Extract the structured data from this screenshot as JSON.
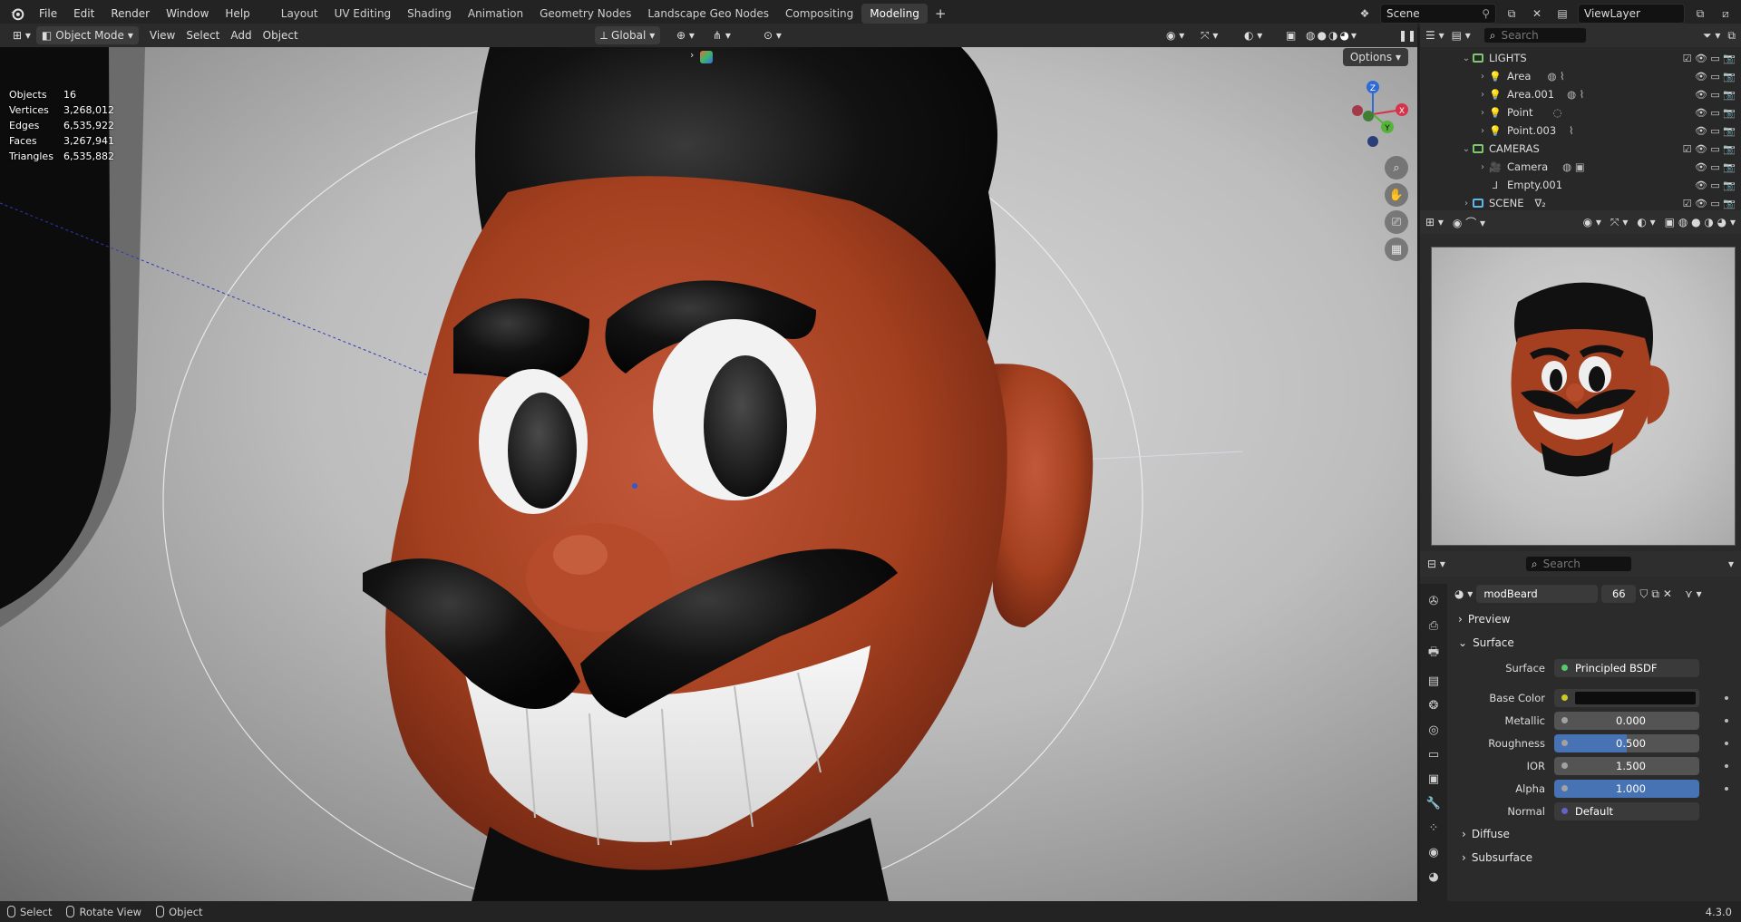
{
  "menu": {
    "file": "File",
    "edit": "Edit",
    "render": "Render",
    "window": "Window",
    "help": "Help"
  },
  "workspaces": [
    {
      "label": "Layout"
    },
    {
      "label": "UV Editing"
    },
    {
      "label": "Shading"
    },
    {
      "label": "Animation"
    },
    {
      "label": "Geometry Nodes"
    },
    {
      "label": "Landscape Geo Nodes"
    },
    {
      "label": "Compositing"
    },
    {
      "label": "Modeling",
      "active": true
    }
  ],
  "top_right": {
    "scene": "Scene",
    "view_layer": "ViewLayer"
  },
  "viewport_header": {
    "mode": "Object Mode",
    "view": "View",
    "select": "Select",
    "add": "Add",
    "object": "Object",
    "orientation": "Global"
  },
  "viewport": {
    "options": "Options",
    "stats": [
      {
        "label": "Objects",
        "value": "16"
      },
      {
        "label": "Vertices",
        "value": "3,268,012"
      },
      {
        "label": "Edges",
        "value": "6,535,922"
      },
      {
        "label": "Faces",
        "value": "3,267,941"
      },
      {
        "label": "Triangles",
        "value": "6,535,882"
      }
    ],
    "gizmo": {
      "z": "Z",
      "y": "Y",
      "x": "X"
    }
  },
  "outliner": {
    "search_placeholder": "Search",
    "rows": [
      {
        "name": "LIGHTS",
        "type": "collection"
      },
      {
        "name": "Area",
        "type": "light"
      },
      {
        "name": "Area.001",
        "type": "light"
      },
      {
        "name": "Point",
        "type": "light"
      },
      {
        "name": "Point.003",
        "type": "light"
      },
      {
        "name": "CAMERAS",
        "type": "collection"
      },
      {
        "name": "Camera",
        "type": "camera"
      },
      {
        "name": "Empty.001",
        "type": "empty"
      },
      {
        "name": "SCENE",
        "type": "collection"
      }
    ]
  },
  "properties": {
    "search_placeholder": "Search",
    "material_name": "modBeard",
    "user_count": "66",
    "sections": {
      "preview": "Preview",
      "surface": "Surface",
      "diffuse": "Diffuse",
      "subsurface": "Subsurface"
    },
    "surface_shader": "Principled BSDF",
    "rows": [
      {
        "label": "Base Color",
        "value": "",
        "socket": "#c9c926"
      },
      {
        "label": "Metallic",
        "value": "0.000",
        "socket": "#a1a1a1"
      },
      {
        "label": "Roughness",
        "value": "0.500",
        "socket": "#a1a1a1"
      },
      {
        "label": "IOR",
        "value": "1.500",
        "socket": "#a1a1a1"
      },
      {
        "label": "Alpha",
        "value": "1.000",
        "socket": "#a1a1a1"
      },
      {
        "label": "Normal",
        "value": "Default",
        "socket": "#6363c7"
      }
    ],
    "surface_label": "Surface"
  },
  "statusbar": {
    "select": "Select",
    "rotate": "Rotate View",
    "object": "Object",
    "version": "4.3.0"
  },
  "colors": {
    "accent": "#4772b3",
    "skin": "#b0482a",
    "hair": "#141414",
    "active_tab": "#3a3a3a"
  }
}
